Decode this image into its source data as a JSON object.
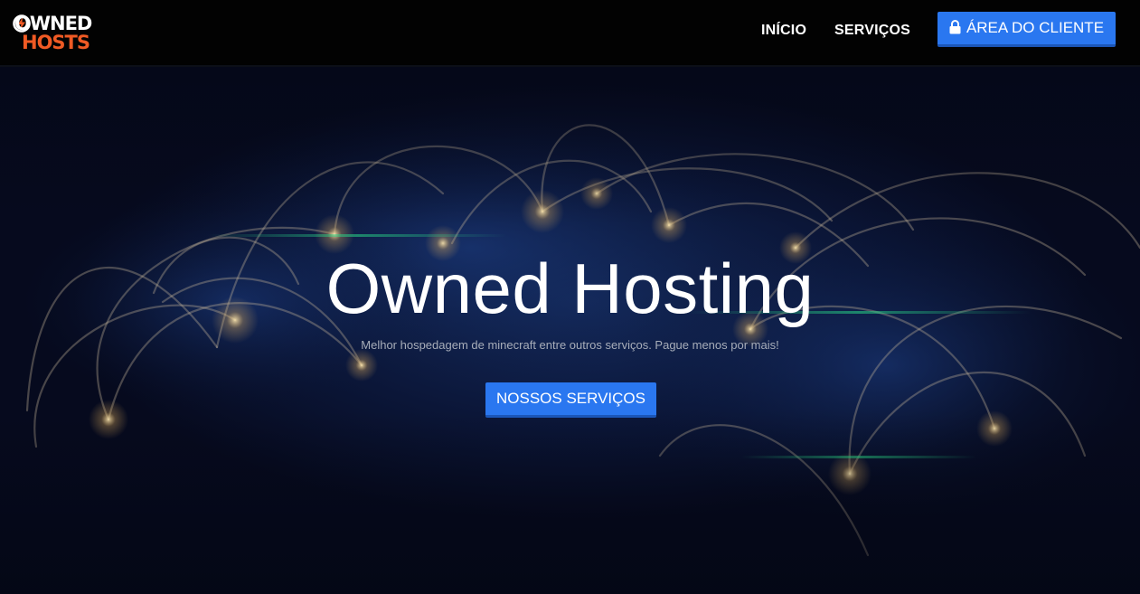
{
  "brand": {
    "logo_line1": "OWNED",
    "logo_line2": "HOSTS",
    "logo_icon": "flame-logo-icon",
    "accent": "#f05a24"
  },
  "nav": {
    "items": [
      {
        "label": "INÍCIO"
      },
      {
        "label": "SERVIÇOS"
      }
    ],
    "client_area": {
      "icon": "lock-icon",
      "label": "ÁREA DO CLIENTE"
    }
  },
  "hero": {
    "title": "Owned Hosting",
    "subtitle": "Melhor hospedagem de minecraft entre outros serviços. Pague menos por mais!",
    "cta_label": "NOSSOS SERVIÇOS"
  },
  "colors": {
    "navbar_bg": "#020202",
    "button_primary": "#2a77f0",
    "hero_bg": "#05081a",
    "text_white": "#ffffff"
  }
}
